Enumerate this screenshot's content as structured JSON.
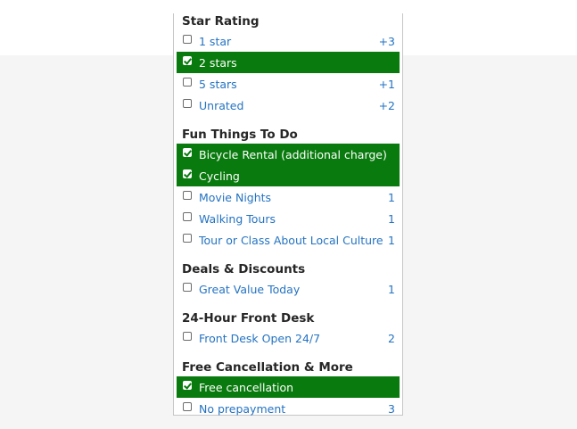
{
  "sections": [
    {
      "title": "Star Rating",
      "items": [
        {
          "label": "1 star",
          "count": "+3",
          "checked": false
        },
        {
          "label": "2 stars",
          "count": "",
          "checked": true
        },
        {
          "label": "5 stars",
          "count": "+1",
          "checked": false
        },
        {
          "label": "Unrated",
          "count": "+2",
          "checked": false
        }
      ]
    },
    {
      "title": "Fun Things To Do",
      "items": [
        {
          "label": "Bicycle Rental (additional charge)",
          "count": "",
          "checked": true
        },
        {
          "label": "Cycling",
          "count": "",
          "checked": true
        },
        {
          "label": "Movie Nights",
          "count": "1",
          "checked": false
        },
        {
          "label": "Walking Tours",
          "count": "1",
          "checked": false
        },
        {
          "label": "Tour or Class About Local Culture",
          "count": "1",
          "checked": false
        }
      ]
    },
    {
      "title": "Deals & Discounts",
      "items": [
        {
          "label": "Great Value Today",
          "count": "1",
          "checked": false
        }
      ]
    },
    {
      "title": "24-Hour Front Desk",
      "items": [
        {
          "label": "Front Desk Open 24/7",
          "count": "2",
          "checked": false
        }
      ]
    },
    {
      "title": "Free Cancellation & More",
      "items": [
        {
          "label": "Free cancellation",
          "count": "",
          "checked": true
        },
        {
          "label": "No prepayment",
          "count": "3",
          "checked": false
        }
      ]
    }
  ],
  "colors": {
    "selected_bg": "#097a0d",
    "link": "#2473c2",
    "heading": "#262626"
  },
  "icons": {
    "checkbox": "checkbox-icon"
  }
}
